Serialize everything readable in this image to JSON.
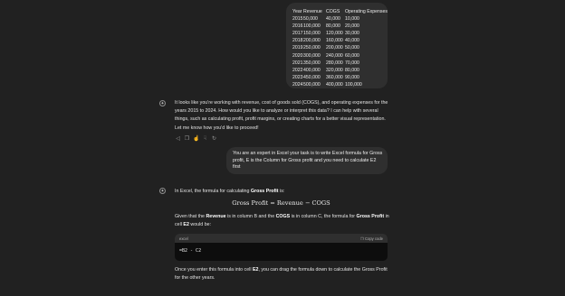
{
  "user_table": {
    "header": [
      "Year",
      "Revenue",
      "COGS",
      "Operating Expenses"
    ],
    "rows": [
      [
        "2015",
        "50,000",
        "40,000",
        "10,000"
      ],
      [
        "2016",
        "100,000",
        "80,000",
        "20,000"
      ],
      [
        "2017",
        "150,000",
        "120,000",
        "30,000"
      ],
      [
        "2018",
        "200,000",
        "160,000",
        "40,000"
      ],
      [
        "2019",
        "250,000",
        "200,000",
        "50,000"
      ],
      [
        "2020",
        "300,000",
        "240,000",
        "60,000"
      ],
      [
        "2021",
        "350,000",
        "280,000",
        "70,000"
      ],
      [
        "2022",
        "400,000",
        "320,000",
        "80,000"
      ],
      [
        "2023",
        "450,000",
        "360,000",
        "90,000"
      ],
      [
        "2024",
        "500,000",
        "400,000",
        "100,000"
      ]
    ]
  },
  "assistant_1": {
    "text": "It looks like you're working with revenue, cost of goods sold (COGS), and operating expenses for the years 2015 to 2024. How would you like to analyze or interpret this data? I can help with several things, such as calculating profit, profit margins, or creating charts for a better visual representation. Let me know how you'd like to proceed!"
  },
  "actions": {
    "icons": [
      "speaker-icon",
      "copy-icon",
      "thumbs-up-icon",
      "thumbs-down-icon",
      "regenerate-icon"
    ]
  },
  "user_question": {
    "text": "You are an expert in Excel your task is to write Excel formula for Gross profit, E is the Column for Gross profit and you need to calculate E2 first"
  },
  "assistant_2": {
    "intro_prefix": "In Excel, the formula for calculating ",
    "intro_bold": "Gross Profit",
    "intro_suffix": " is:",
    "formula": "Gross Profit = Revenue − COGS",
    "given_1": "Given that the ",
    "given_b1": "Revenue",
    "given_2": " is in column B and the ",
    "given_b2": "COGS",
    "given_3": " is in column C, the formula for ",
    "given_b3": "Gross Profit",
    "given_4": " in cell ",
    "given_b4": "E2",
    "given_5": " would be:",
    "code_lang": "excel",
    "copy_label": "Copy code",
    "code": "=B2 - C2",
    "outro_1": "Once you enter this formula into cell ",
    "outro_b": "E2",
    "outro_2": ", you can drag the formula down to calculate the Gross Profit for the other years."
  }
}
